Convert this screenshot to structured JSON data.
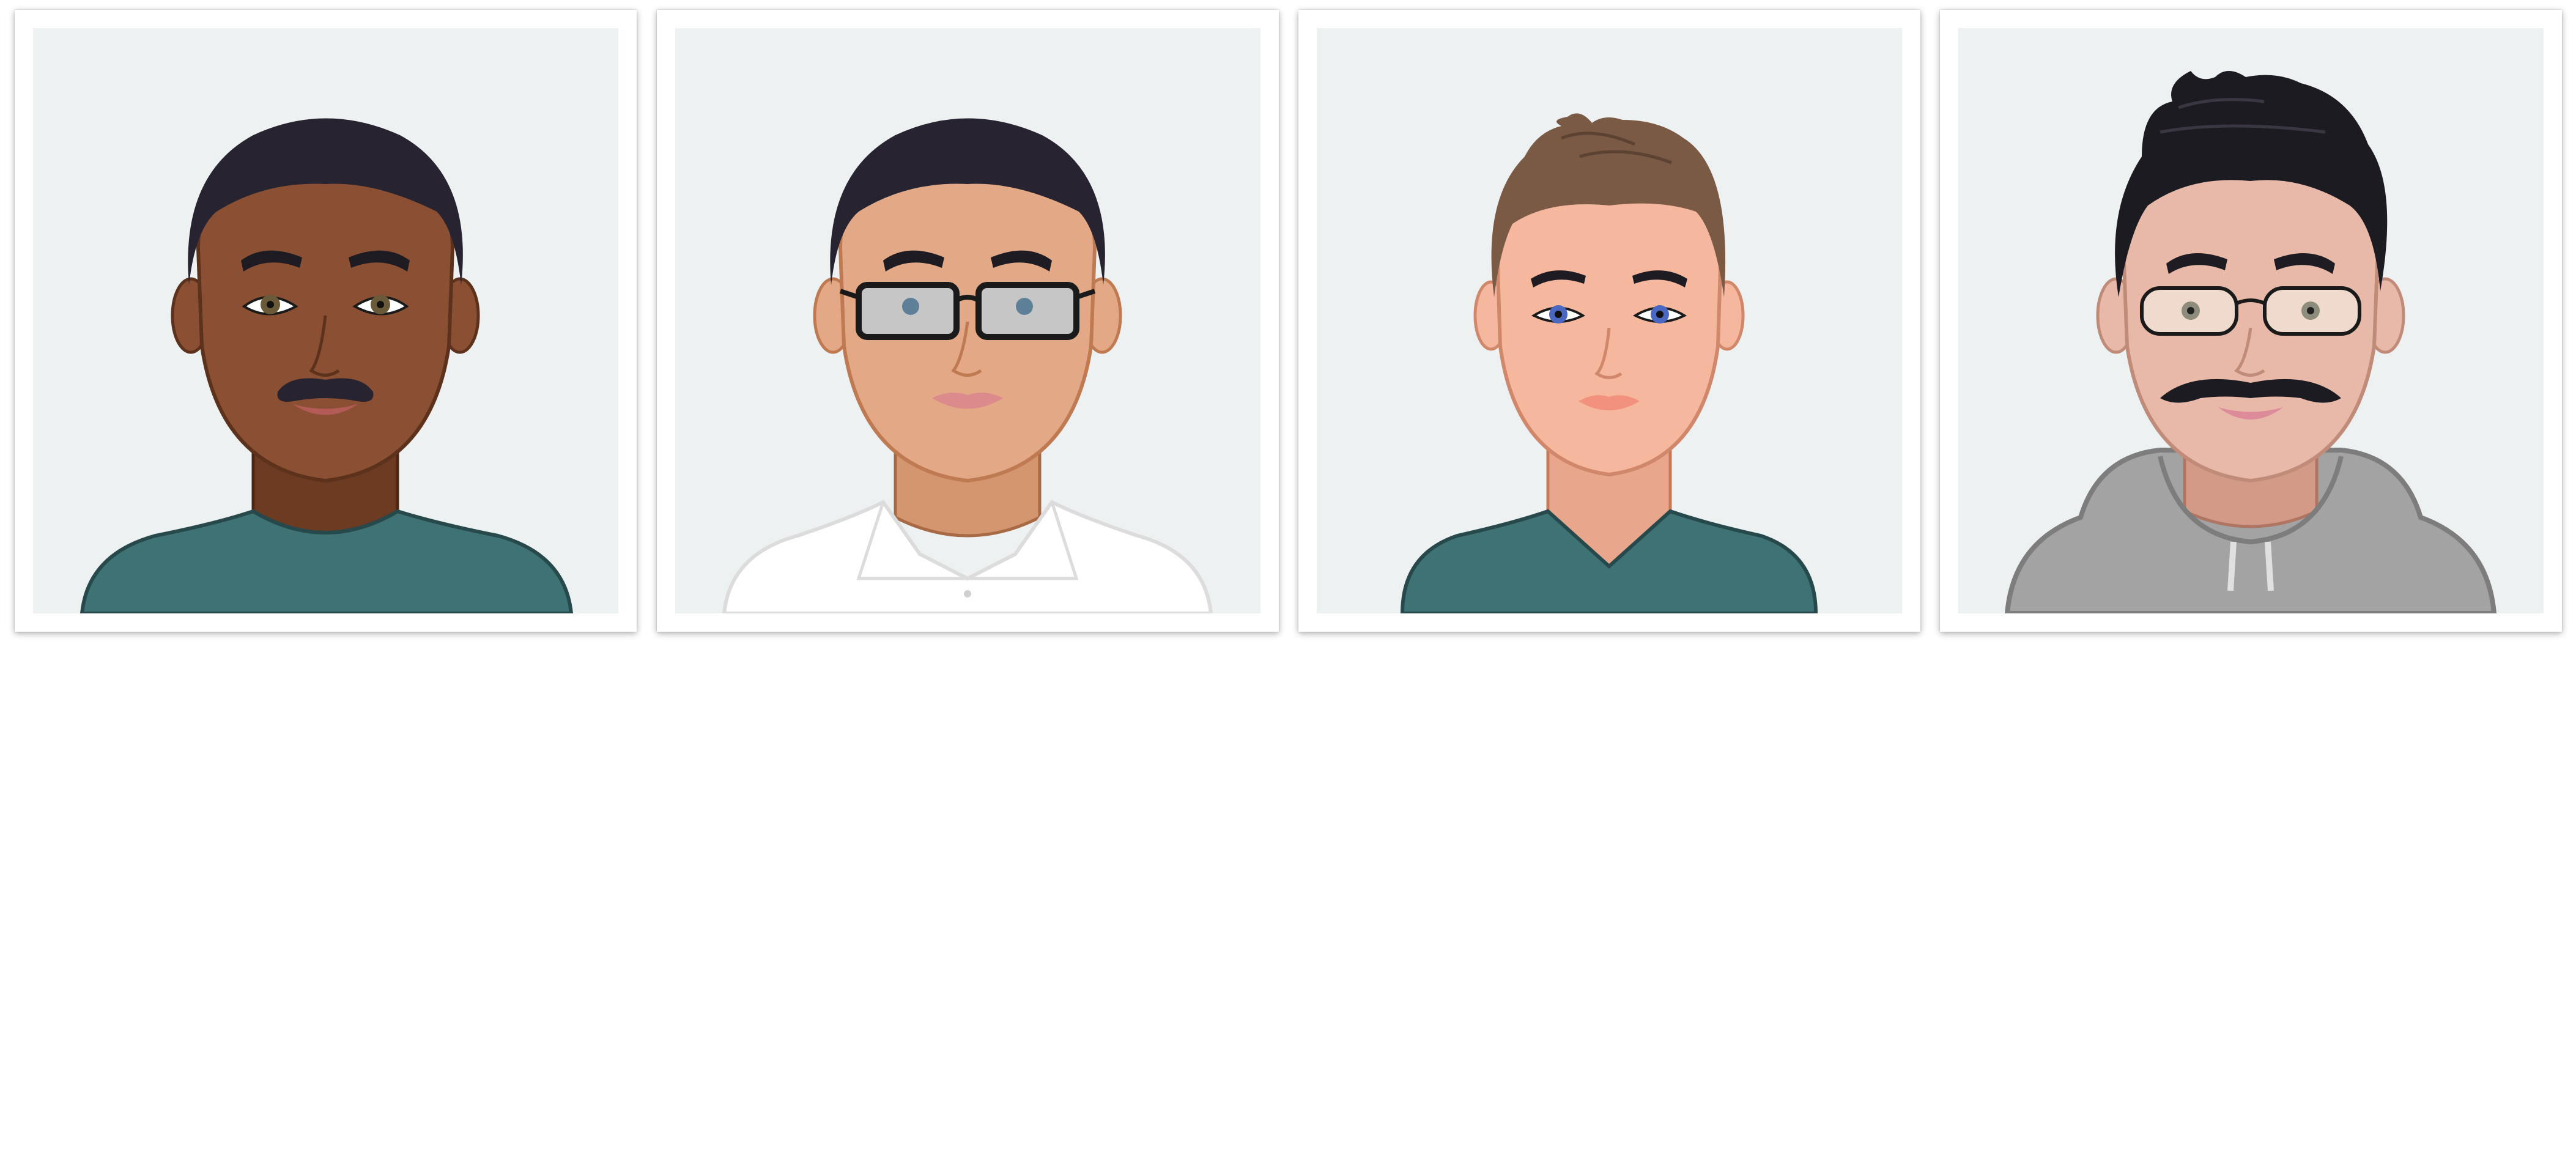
{
  "gallery": {
    "avatars": [
      {
        "icon": "avatar-man-mustache-dark-skin-icon",
        "skin": "#8b5033",
        "hair": "#272330",
        "shirt": "#3f7275"
      },
      {
        "icon": "avatar-man-glasses-white-shirt-icon",
        "skin": "#e3a987",
        "hair": "#272330",
        "shirt": "#ffffff"
      },
      {
        "icon": "avatar-man-brown-quiff-vneck-icon",
        "skin": "#f5b79e",
        "hair": "#7a5a44",
        "shirt": "#3f7275"
      },
      {
        "icon": "avatar-man-glasses-mustache-hoodie-icon",
        "skin": "#e8b9a8",
        "hair": "#1d1b22",
        "shirt": "#a3a3a3"
      }
    ]
  }
}
